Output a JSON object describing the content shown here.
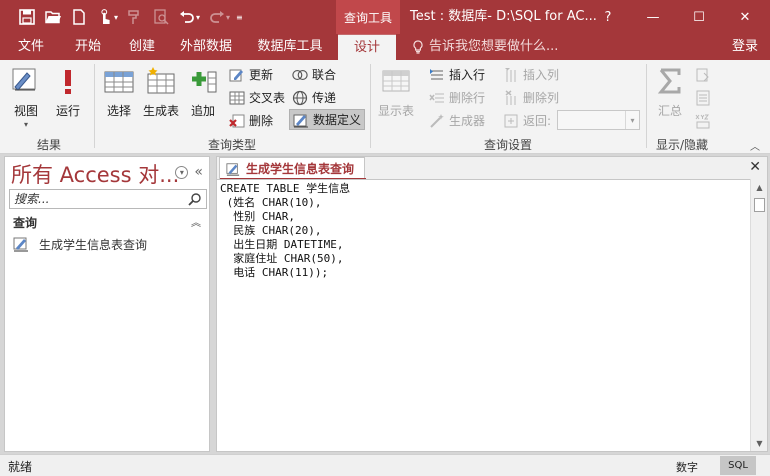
{
  "titlebar": {
    "context_group": "查询工具",
    "window_title": "Test : 数据库- D:\\SQL for AC...",
    "help": "?",
    "minimize": "—",
    "restore": "☐",
    "close": "✕"
  },
  "tabs": [
    "文件",
    "开始",
    "创建",
    "外部数据",
    "数据库工具",
    "设计"
  ],
  "active_tab": "设计",
  "tellme": "告诉我您想要做什么...",
  "login": "登录",
  "ribbon": {
    "results": {
      "label": "结果",
      "view": "视图",
      "run": "运行"
    },
    "query_type": {
      "label": "查询类型",
      "select": "选择",
      "make_table": "生成表",
      "append": "追加",
      "update": "更新",
      "crosstab": "交叉表",
      "delete": "删除",
      "union": "联合",
      "pass_through": "传递",
      "data_definition": "数据定义"
    },
    "query_setup": {
      "label": "查询设置",
      "show_table": "显示表",
      "insert_rows": "插入行",
      "delete_rows": "删除行",
      "builder": "生成器",
      "insert_columns": "插入列",
      "delete_columns": "删除列",
      "return": "返回:"
    },
    "show_hide": {
      "label": "显示/隐藏",
      "totals": "汇总"
    }
  },
  "nav": {
    "title": "所有 Access 对...",
    "search_placeholder": "搜索...",
    "group": "查询",
    "items": [
      {
        "label": "生成学生信息表查询"
      }
    ]
  },
  "document": {
    "tab_label": "生成学生信息表查询",
    "sql_lines": [
      "CREATE TABLE 学生信息",
      " (姓名 CHAR(10),",
      "  性别 CHAR,",
      "  民族 CHAR(20),",
      "  出生日期 DATETIME,",
      "  家庭住址 CHAR(50),",
      "  电话 CHAR(11));"
    ]
  },
  "status": {
    "left": "就绪",
    "mode": "数字",
    "view": "SQL"
  },
  "colors": {
    "accent": "#a4373a",
    "ribbon_bg": "#f3f3f3",
    "body_bg": "#d6d6d6"
  }
}
